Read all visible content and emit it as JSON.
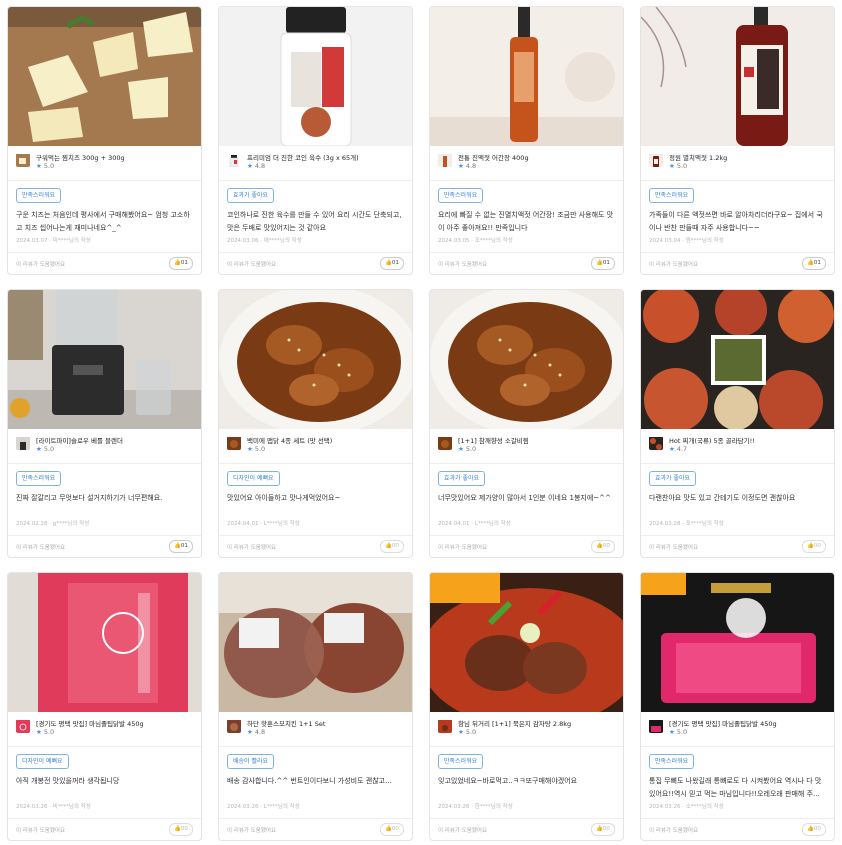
{
  "cards": [
    {
      "product": "구워먹는 찜치즈 300g + 300g",
      "rating": "5.0",
      "badge": "만족스러워요",
      "review": "구운 치즈는 처음인데 평사에서 구매해봤어요~ 엄청 고소하고 치즈 씹어나는게 재미나네요^_^",
      "meta": "2024.03.07 · 미****님의 작성",
      "helpful": "이 리뷰가 도움됐어요",
      "likes": "01",
      "img": "cheese"
    },
    {
      "product": "프리미엄 더 진한 코인 육수 (3g x 65개)",
      "rating": "4.8",
      "badge": "효과가 좋아요",
      "review": "코인하나로 진한 육수를 만들 수 있어 요리 시간도 단축되고, 맛은 두배로 맛있어지는 것 같아요",
      "meta": "2024.03.06 · 에****님의 작성",
      "helpful": "이 리뷰가 도움됐어요",
      "likes": "01",
      "img": "jar"
    },
    {
      "product": "전통 진액젓 어간장 400g",
      "rating": "4.8",
      "badge": "만족스러워요",
      "review": "요리에 빠질 수 없는 진멸치액젓 어간장! 조금만 사용해도 맛이 아주 좋아져요!! 만족입니다",
      "meta": "2024.03.05 · 조****님의 작성",
      "helpful": "이 리뷰가 도움됐어요",
      "likes": "01",
      "img": "bottle1"
    },
    {
      "product": "정원 멸치액젓 1.2kg",
      "rating": "5.0",
      "badge": "만족스러워요",
      "review": "가족들이 다른 액젓쓰면 바로 알아차리더라구요~ 집에서 국이나 반찬 만들때 자주 사용합니다~~",
      "meta": "2024.03.04 · 원****님의 작성",
      "helpful": "이 리뷰가 도움됐어요",
      "likes": "01",
      "img": "bottle2"
    },
    {
      "product": "[라이트파이]슬로우 베를 블렌더",
      "rating": "5.0",
      "badge": "만족스러워요",
      "review": "진짜 잘갈리고 무엇보다 설거지하기가 너무편해요.",
      "meta": "2024.02.28 · g****님의 작성",
      "helpful": "이 리뷰가 도움됐어요",
      "likes": "01",
      "img": "blender"
    },
    {
      "product": "백미에 맵닭 4종 세트 (맛 선택)",
      "rating": "5.0",
      "badge": "디자인이 예뻐요",
      "review": "맛있어요 아이들하고 맛나게먹었어요~",
      "meta": "2024.04.01 · L****님의 작성",
      "helpful": "이 리뷰가 도움됐어요",
      "likes": "00",
      "img": "chicken"
    },
    {
      "product": "[1+1] 참깨향성 소갈비찜",
      "rating": "5.0",
      "badge": "효과가 좋아요",
      "review": "너무맛있어요 제가양이 많아서 1인분 이네요 1봉지에~^^",
      "meta": "2024.04.01 · L****님의 작성",
      "helpful": "이 리뷰가 도움됐어요",
      "likes": "00",
      "img": "chicken"
    },
    {
      "product": "Hot 찌개(국류) 5종 골라담기!!",
      "rating": "4.7",
      "badge": "효과가 좋아요",
      "review": "다랜찬아요 맛도 있고 간테기도 이정도면 괜찮아요",
      "meta": "2024.03.28 · 포****님의 작성",
      "helpful": "이 리뷰가 도움됐어요",
      "likes": "00",
      "img": "stew"
    },
    {
      "product": "[경기도 평택 맛집] 마님졸팁닭발 450g",
      "rating": "5.0",
      "badge": "디자인이 예뻐요",
      "review": "아직 개봉전 맛있을꺼라 생각됩니당",
      "meta": "2024.03.26 · 비****님의 작성",
      "helpful": "이 리뷰가 도움됐어요",
      "likes": "00",
      "img": "pack1"
    },
    {
      "product": "하단 핫훈스모치킨 1+1 Set",
      "rating": "4.8",
      "badge": "배송이 빨라요",
      "review": "배송 감사합니다.^^ 번트인이다보니 가성비도 괜찮고...",
      "meta": "2024.03.26 · L****님의 작성",
      "helpful": "이 리뷰가 도움됐어요",
      "likes": "00",
      "img": "meat"
    },
    {
      "product": "항님 뒤거리 [1+1] 묵은지 감자탕 2.8kg",
      "rating": "5.0",
      "badge": "만족스러워요",
      "review": "잊고있었네요~바로먹고..ㅋㅋ또구매해야겠어요",
      "meta": "2024.03.26 · 한****님의 작성",
      "helpful": "이 리뷰가 도움됐어요",
      "likes": "00",
      "img": "soup"
    },
    {
      "product": "[경기도 평택 맛집] 마님졸팁닭발 450g",
      "rating": "5.0",
      "badge": "만족스러워요",
      "review": "통집 무뼈도 나왔길래 통뼈로도 다 시켜봤어요 역시나 다 맛있어요!!역시 믿고 먹는 마님입니다!!오레오래 판매해 주...",
      "meta": "2024.03.26 · 소****님의 작성",
      "helpful": "이 리뷰가 도움됐어요",
      "likes": "00",
      "img": "pack2"
    }
  ]
}
